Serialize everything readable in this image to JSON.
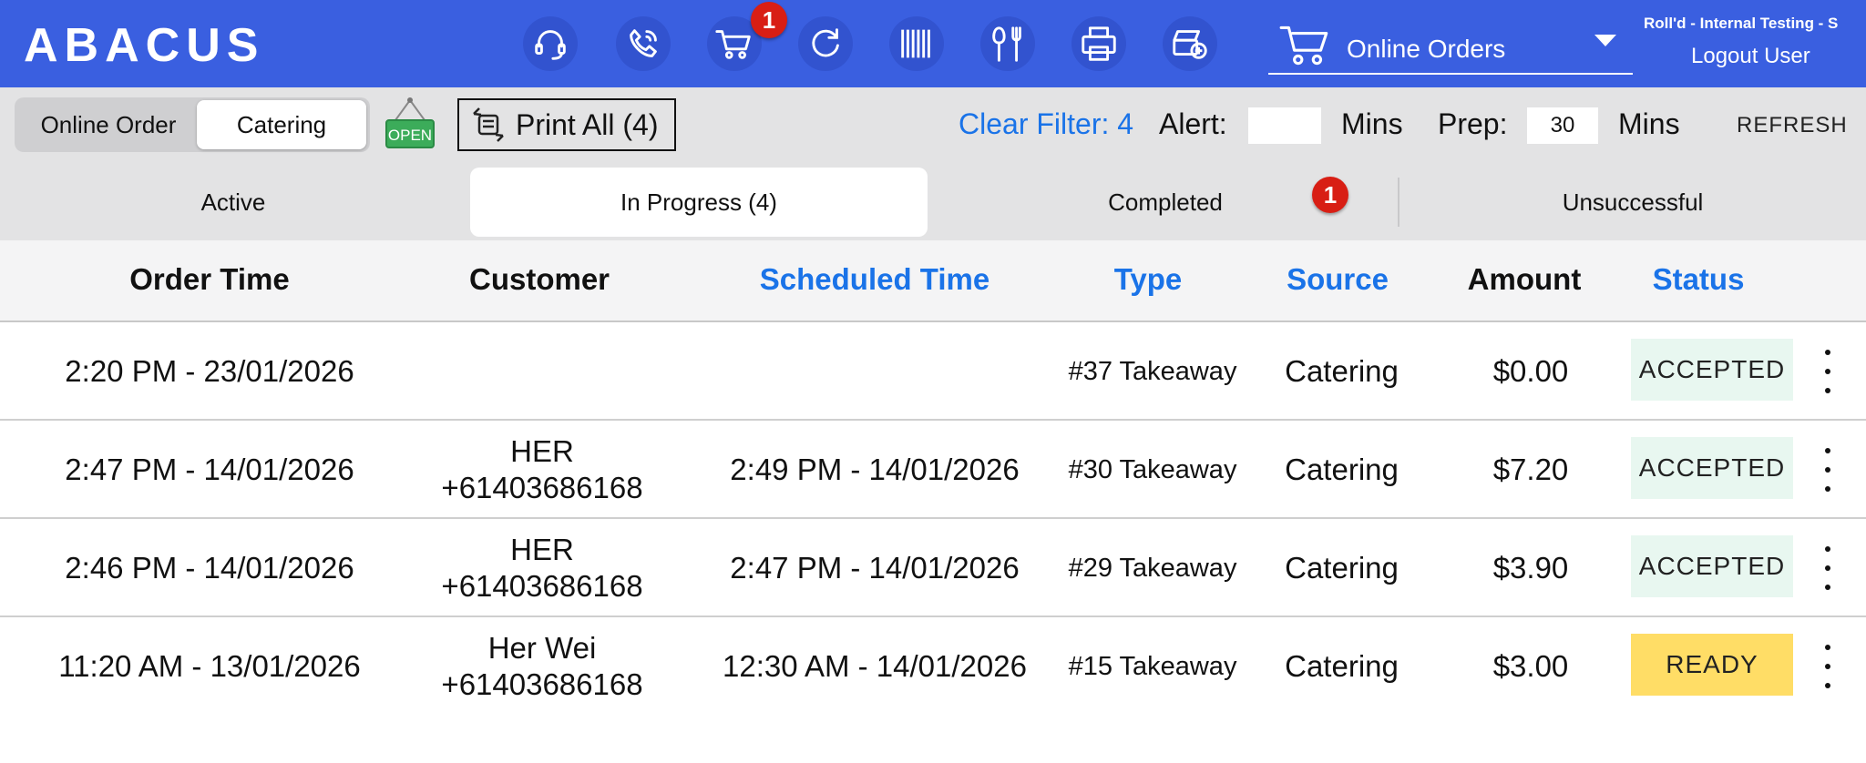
{
  "header": {
    "logo": "ABACUS",
    "cart_badge": "1",
    "mode_selector": "Online Orders",
    "store_name": "Roll'd - Internal Testing - S",
    "logout_label": "Logout User"
  },
  "toolbar": {
    "segments": [
      {
        "label": "Online Order"
      },
      {
        "label": "Catering"
      }
    ],
    "open_sign_text": "OPEN",
    "print_all_label": "Print All (4)",
    "clear_filter_label": "Clear Filter: 4",
    "alert_label": "Alert:",
    "alert_value": "",
    "alert_unit": "Mins",
    "prep_label": "Prep:",
    "prep_value": "30",
    "prep_unit": "Mins",
    "refresh_label": "REFRESH"
  },
  "tabs": {
    "items": [
      {
        "label": "Active"
      },
      {
        "label": "In Progress (4)"
      },
      {
        "label": "Completed"
      },
      {
        "label": "Unsuccessful"
      }
    ],
    "completed_badge": "1"
  },
  "table": {
    "headers": [
      "Order Time",
      "Customer",
      "Scheduled Time",
      "Type",
      "Source",
      "Amount",
      "Status"
    ],
    "rows": [
      {
        "order_time": "2:20 PM - 23/01/2026",
        "customer_name": "",
        "customer_phone": "",
        "scheduled_time": "",
        "type": "#37 Takeaway",
        "source": "Catering",
        "amount": "$0.00",
        "status": "ACCEPTED"
      },
      {
        "order_time": "2:47 PM - 14/01/2026",
        "customer_name": "HER",
        "customer_phone": "+61403686168",
        "scheduled_time": "2:49 PM - 14/01/2026",
        "type": "#30 Takeaway",
        "source": "Catering",
        "amount": "$7.20",
        "status": "ACCEPTED"
      },
      {
        "order_time": "2:46 PM - 14/01/2026",
        "customer_name": "HER",
        "customer_phone": "+61403686168",
        "scheduled_time": "2:47 PM - 14/01/2026",
        "type": "#29 Takeaway",
        "source": "Catering",
        "amount": "$3.90",
        "status": "ACCEPTED"
      },
      {
        "order_time": "11:20 AM - 13/01/2026",
        "customer_name": "Her Wei",
        "customer_phone": "+61403686168",
        "scheduled_time": "12:30 AM - 14/01/2026",
        "type": "#15 Takeaway",
        "source": "Catering",
        "amount": "$3.00",
        "status": "READY"
      }
    ]
  },
  "colors": {
    "header_bg": "#3a5fe0",
    "link_blue": "#1a73e8",
    "badge_red": "#d81e14",
    "status_accepted_bg": "#e8f7f0",
    "status_ready_bg": "#ffdd66"
  }
}
